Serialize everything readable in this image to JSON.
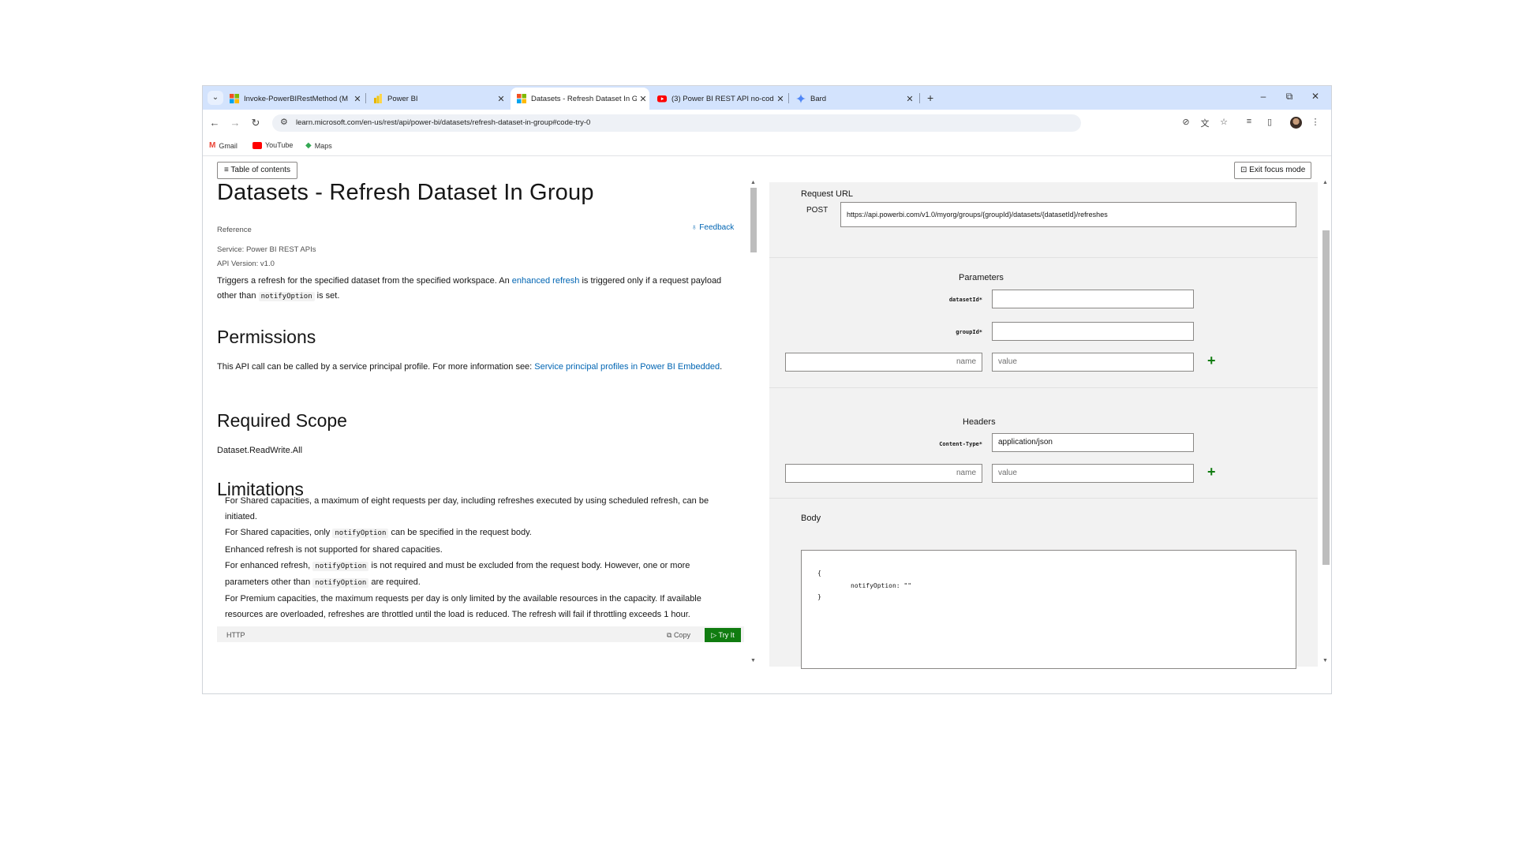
{
  "browser": {
    "tabs": [
      {
        "title": "Invoke-PowerBIRestMethod (M",
        "favicon": "microsoft-icon"
      },
      {
        "title": "Power BI",
        "favicon": "powerbi-icon"
      },
      {
        "title": "Datasets - Refresh Dataset In G",
        "favicon": "microsoft-icon"
      },
      {
        "title": "(3) Power BI REST API no-code",
        "favicon": "youtube-icon"
      },
      {
        "title": "Bard",
        "favicon": "bard-icon"
      }
    ],
    "active_tab": 2,
    "url": "learn.microsoft.com/en-us/rest/api/power-bi/datasets/refresh-dataset-in-group#code-try-0",
    "bookmarks": [
      "Gmail",
      "YouTube",
      "Maps"
    ]
  },
  "page": {
    "toc_button": "≡ Table of contents",
    "exit_focus_button": "⊡ Exit focus mode",
    "title": "Datasets - Refresh Dataset In Group",
    "reference": "Reference",
    "feedback": "Feedback",
    "service": "Service:  Power BI REST APIs",
    "api_version": "API Version:  v1.0",
    "intro": {
      "before": "Triggers a refresh for the specified dataset from the specified workspace. An ",
      "link": "enhanced refresh",
      "after": " is triggered only if a request payload other than ",
      "code": "notifyOption",
      "end": " is set."
    },
    "permissions_heading": "Permissions",
    "permissions_text": "This API call can be called by a service principal profile. For more information see: ",
    "permissions_link": "Service principal profiles in Power BI Embedded",
    "permissions_end": ".",
    "scope_heading": "Required Scope",
    "scope_text": "Dataset.ReadWrite.All",
    "limitations_heading": "Limitations",
    "limitations": {
      "l1": "For Shared capacities, a maximum of eight requests per day, including refreshes executed by using scheduled refresh, can be initiated.",
      "l2a": "For Shared capacities, only ",
      "l2code": "notifyOption",
      "l2b": " can be specified in the request body.",
      "l3": "Enhanced refresh is not supported for shared capacities.",
      "l4a": "For enhanced refresh, ",
      "l4code": "notifyOption",
      "l4b": " is not required and must be excluded from the request body. However, one or more parameters other than ",
      "l4code2": "notifyOption",
      "l4c": " are required.",
      "l5": "For Premium capacities, the maximum requests per day is only limited by the available resources in the capacity. If available resources are overloaded, refreshes are throttled until the load is reduced. The refresh will fail if throttling exceeds 1 hour."
    },
    "code_lang": "HTTP",
    "copy_label": "Copy",
    "tryit_label": "▷ Try It"
  },
  "tryit": {
    "request_url_label": "Request URL",
    "method": "POST",
    "request_url": "https://api.powerbi.com/v1.0/myorg/groups/{groupId}/datasets/{datasetId}/refreshes",
    "parameters_heading": "Parameters",
    "param1_label": "datasetId*",
    "param2_label": "groupId*",
    "name_placeholder": "name",
    "value_placeholder": "value",
    "headers_heading": "Headers",
    "header1_label": "Content-Type*",
    "header1_value": "application/json",
    "body_label": "Body",
    "body_open": "{",
    "body_line": "notifyOption: \"\"",
    "body_close": "}"
  }
}
